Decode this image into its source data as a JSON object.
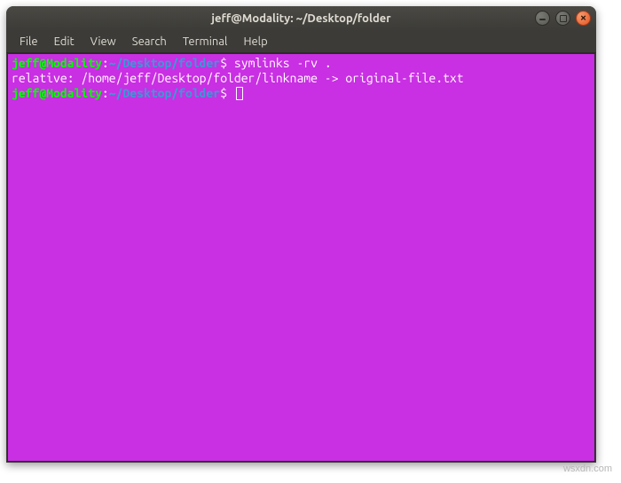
{
  "window": {
    "title": "jeff@Modality: ~/Desktop/folder"
  },
  "menu": {
    "items": [
      "File",
      "Edit",
      "View",
      "Search",
      "Terminal",
      "Help"
    ]
  },
  "terminal": {
    "lines": [
      {
        "user": "jeff@Modality",
        "sep": ":",
        "path": "~/Desktop/folder",
        "prompt": "$",
        "command": "symlinks -rv ."
      }
    ],
    "output": "relative: /home/jeff/Desktop/folder/linkname -> original-file.txt",
    "current": {
      "user": "jeff@Modality",
      "sep": ":",
      "path": "~/Desktop/folder",
      "prompt": "$"
    }
  },
  "watermark": "wsxdn.com"
}
